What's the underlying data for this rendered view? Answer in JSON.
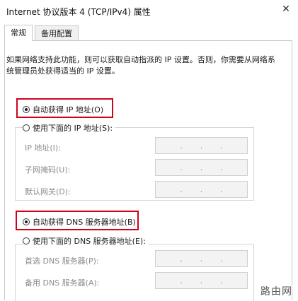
{
  "window": {
    "title": "Internet 协议版本 4 (TCP/IPv4) 属性",
    "close_glyph": "✕"
  },
  "tabs": [
    {
      "label": "常规",
      "active": true
    },
    {
      "label": "备用配置",
      "active": false
    }
  ],
  "description": "如果网络支持此功能，则可以获取自动指派的 IP 设置。否则，你需要从网络系统管理员处获得适当的 IP 设置。",
  "ip_section": {
    "auto_label": "自动获得 IP 地址(O)",
    "auto_selected": true,
    "manual_label": "使用下面的 IP 地址(S):",
    "manual_selected": false,
    "fields": [
      {
        "label": "IP 地址(I):",
        "dots": [
          ".",
          ".",
          "."
        ]
      },
      {
        "label": "子网掩码(U):",
        "dots": [
          ".",
          ".",
          "."
        ]
      },
      {
        "label": "默认网关(D):",
        "dots": [
          ".",
          ".",
          "."
        ]
      }
    ]
  },
  "dns_section": {
    "auto_label": "自动获得 DNS 服务器地址(B)",
    "auto_selected": true,
    "manual_label": "使用下面的 DNS 服务器地址(E):",
    "manual_selected": false,
    "fields": [
      {
        "label": "首选 DNS 服务器(P):",
        "dots": [
          ".",
          ".",
          "."
        ]
      },
      {
        "label": "备用 DNS 服务器(A):",
        "dots": [
          ".",
          ".",
          "."
        ]
      }
    ]
  },
  "watermark": "路由网",
  "colors": {
    "highlight": "#d0021b",
    "disabled_text": "#8c8c8c",
    "field_bg": "#f3f3f3"
  }
}
